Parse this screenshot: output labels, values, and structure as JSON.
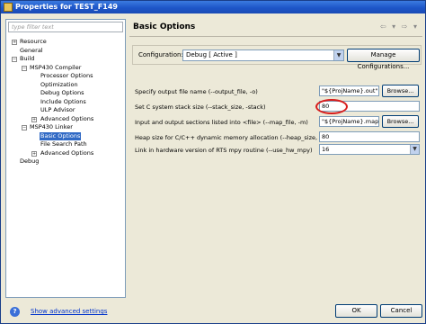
{
  "window": {
    "title": "Properties for TEST_F149"
  },
  "filter": {
    "placeholder": "type filter text"
  },
  "tree": {
    "resource": "Resource",
    "general": "General",
    "build": "Build",
    "compiler": "MSP430 Compiler",
    "processor_options": "Processor Options",
    "optimization": "Optimization",
    "debug_options": "Debug Options",
    "include_options": "Include Options",
    "ulp_advisor": "ULP Advisor",
    "advanced_options_compiler": "Advanced Options",
    "linker": "MSP430 Linker",
    "basic_options": "Basic Options",
    "file_search_path": "File Search Path",
    "advanced_options_linker": "Advanced Options",
    "debug": "Debug"
  },
  "page": {
    "heading": "Basic Options",
    "nav_icons": "⇦ ▾ ⇨ ▾"
  },
  "config": {
    "label": "Configuration:",
    "value": "Debug  [ Active ]",
    "manage_label": "Manage Configurations..."
  },
  "options": [
    {
      "label": "Specify output file name (--output_file, -o)",
      "value": "\"${ProjName}.out\"",
      "button": "Browse..."
    },
    {
      "label": "Set C system stack size (--stack_size, -stack)",
      "value": "80"
    },
    {
      "label": "Input and output sections listed into <file> (--map_file, -m)",
      "value": "\"${ProjName}.map\"",
      "button": "Browse..."
    },
    {
      "label": "Heap size for C/C++ dynamic memory allocation (--heap_size, -heap)",
      "value": "80"
    },
    {
      "label": "Link in hardware version of RTS mpy routine (--use_hw_mpy)",
      "value": "16"
    }
  ],
  "footer": {
    "help": "?",
    "advanced_link": "Show advanced settings",
    "ok": "OK",
    "cancel": "Cancel"
  },
  "colors": {
    "highlight_ring": "#d81c1c",
    "selection": "#316ac5",
    "title_bar": "#1e56c8"
  }
}
